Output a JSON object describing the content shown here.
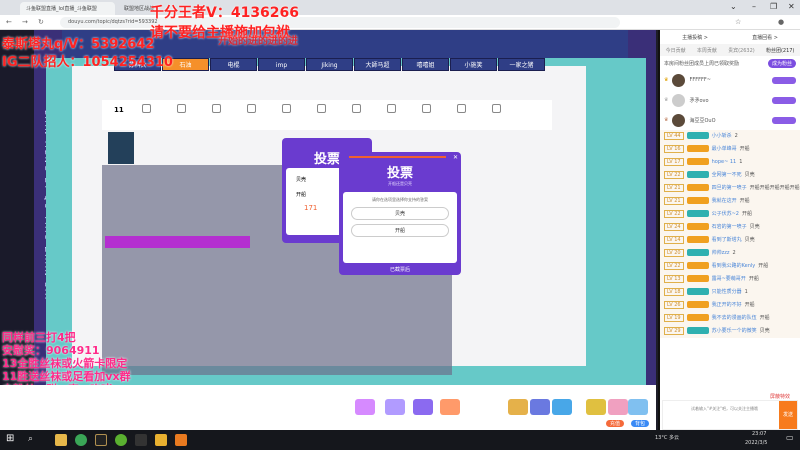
{
  "browser": {
    "tabs": [
      "斗鱼联盟直播_lol直播_斗鱼联盟",
      "联盟地区战战"
    ],
    "url": "douyu.com/topic/dqtzs?rid=593392",
    "window_controls": [
      "chevron-down",
      "minimize",
      "restore",
      "close"
    ]
  },
  "overlay_text": {
    "line1": "千分王者V：4136266",
    "line2": "请不要给主播施加包袱",
    "line3": "泰斯塔丸q/V：5392642",
    "line4": "IG二队招人：1054254310",
    "line5": "开始的进的进的进"
  },
  "overlay_pink": [
    "同样前三打4把",
    "安慰奖：9064911",
    "13全胜丝袜或火箭卡限定",
    "11胜送丝袜或足看加vx群",
    "去粉丝一群一直一咆哮"
  ],
  "stream": {
    "names": [
      "苏科大",
      "石油",
      "电棍",
      "imp",
      "Jiking",
      "大師马超",
      "嘻嘻姐",
      "小施笑",
      "一家之猪"
    ],
    "active_index": 1,
    "side_text": "LIAN MENG DI QU TIAO ZHAN SAI",
    "count": "11",
    "score": "171"
  },
  "vote_popup": {
    "title": "投票",
    "subtitle": "开船还是贝壳",
    "question": "请你在选项里选择你支持的答案",
    "options": [
      "贝壳",
      "开船"
    ],
    "footer": "已截票后"
  },
  "sidebar": {
    "header": [
      "主播投稿 >",
      "直播回看 >"
    ],
    "tabs": [
      "今日贡献",
      "本周贡献",
      "贵宾(2632)",
      "粉丝团(217)"
    ],
    "notice": "本房间粉丝团成员上周已领取奖励",
    "notice_button": "成为粉丝",
    "ranks": [
      {
        "name": "FFFFFF~"
      },
      {
        "name": "矛矛ovo"
      },
      {
        "name": "海豆豆OuO"
      }
    ],
    "chat": [
      {
        "lv": "LV 44",
        "name": "小小斩杀",
        "text": "2"
      },
      {
        "lv": "LV 16",
        "name": "最小单峰哥",
        "text": "开船"
      },
      {
        "lv": "LV 17",
        "name": "hope~ 11",
        "text": "1"
      },
      {
        "lv": "LV 22",
        "name": "全网第一不死",
        "text": "贝壳"
      },
      {
        "lv": "LV 21",
        "name": "四旦的第一喷子",
        "text": "开船开船开船开船开船开船"
      },
      {
        "lv": "LV 21",
        "name": "我就在这开",
        "text": "开船"
      },
      {
        "lv": "LV 22",
        "name": "公子伏苏~2",
        "text": "开船"
      },
      {
        "lv": "LV 24",
        "name": "石岩的第一喷子",
        "text": "贝壳"
      },
      {
        "lv": "LV 14",
        "name": "看到了斯塔丸",
        "text": "贝壳"
      },
      {
        "lv": "LV 20",
        "name": "帅帅zzz",
        "text": "2"
      },
      {
        "lv": "LV 22",
        "name": "看到我公路的Kenly",
        "text": "开船"
      },
      {
        "lv": "LV 13",
        "name": "露哥~要萌哥开",
        "text": "开船"
      },
      {
        "lv": "LV 18",
        "name": "只能性质分器",
        "text": "1"
      },
      {
        "lv": "LV 26",
        "name": "我正开的不好",
        "text": "开船"
      },
      {
        "lv": "LV 19",
        "name": "我不去的漫画的队伍",
        "text": "开船"
      },
      {
        "lv": "LV 29",
        "name": "苏小要乐一个的微笑",
        "text": "贝壳"
      }
    ],
    "input_placeholder": "试着输入\"#关注\"吧，可以关注主播哦",
    "send_label": "发送",
    "block_label": "屏蔽特效"
  },
  "giftbar": {
    "buttons": [
      "充值",
      "背包"
    ]
  },
  "taskbar": {
    "weather": "13°C 多云",
    "time": "23:07",
    "date": "2022/3/5"
  }
}
